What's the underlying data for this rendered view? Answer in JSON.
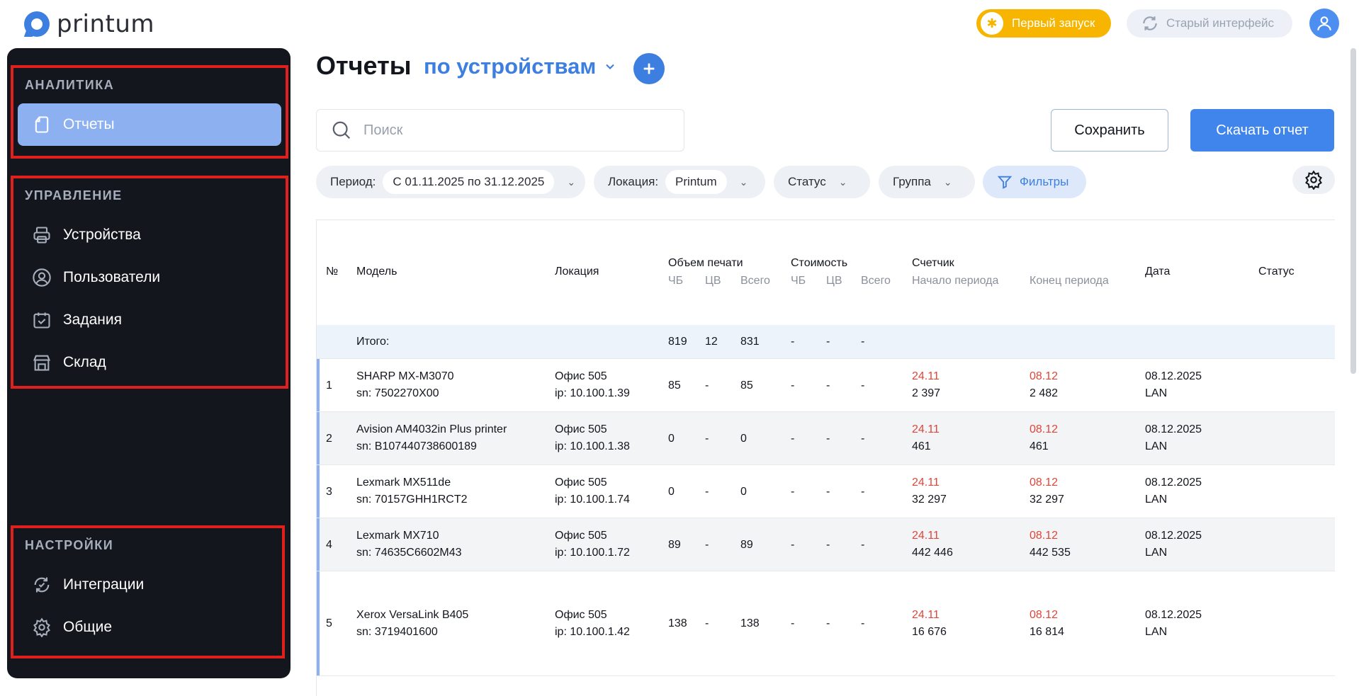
{
  "brand": {
    "name": "printum"
  },
  "header": {
    "first_launch": "Первый запуск",
    "old_interface": "Старый интерфейс"
  },
  "sidebar": {
    "analytics": {
      "title": "АНАЛИТИКА",
      "items": [
        {
          "label": "Отчеты",
          "icon": "document-icon"
        }
      ]
    },
    "management": {
      "title": "УПРАВЛЕНИЕ",
      "items": [
        {
          "label": "Устройства",
          "icon": "printer-icon"
        },
        {
          "label": "Пользователи",
          "icon": "user-icon"
        },
        {
          "label": "Задания",
          "icon": "calendar-check-icon"
        },
        {
          "label": "Склад",
          "icon": "warehouse-icon"
        }
      ]
    },
    "settings": {
      "title": "НАСТРОЙКИ",
      "items": [
        {
          "label": "Интеграции",
          "icon": "sync-icon"
        },
        {
          "label": "Общие",
          "icon": "gear-icon"
        }
      ]
    }
  },
  "main": {
    "title": "Отчеты",
    "subtitle": "по устройствам",
    "search_placeholder": "Поиск",
    "save": "Сохранить",
    "download": "Скачать отчет",
    "filters": {
      "period_label": "Период:",
      "period_value": "С 01.11.2025 по 31.12.2025",
      "location_label": "Локация:",
      "location_value": "Printum",
      "status": "Статус",
      "group": "Группа",
      "filters": "Фильтры"
    }
  },
  "table": {
    "headers": {
      "num": "№",
      "model": "Модель",
      "location": "Локация",
      "volume": "Объем печати",
      "cost": "Стоимость",
      "counter": "Счетчик",
      "date": "Дата",
      "status": "Статус",
      "bw": "ЧБ",
      "color": "ЦВ",
      "total": "Всего",
      "period_start": "Начало периода",
      "period_end": "Конец периода"
    },
    "total_row": {
      "label": "Итого:",
      "bw": "819",
      "color": "12",
      "total": "831",
      "c_bw": "-",
      "c_color": "-",
      "c_total": "-"
    },
    "rows": [
      {
        "n": "1",
        "model": "SHARP MX-M3070",
        "sn": "sn: 7502270X00",
        "loc": "Офис 505",
        "ip": "ip: 10.100.1.39",
        "bw": "85",
        "color": "-",
        "total": "85",
        "c_bw": "-",
        "c_color": "-",
        "c_total": "-",
        "start_date": "24.11",
        "start_val": "2 397",
        "end_date": "08.12",
        "end_val": "2 482",
        "date": "08.12.2025",
        "conn": "LAN"
      },
      {
        "n": "2",
        "model": "Avision AM4032in Plus printer",
        "sn": "sn: B107440738600189",
        "loc": "Офис 505",
        "ip": "ip: 10.100.1.38",
        "bw": "0",
        "color": "-",
        "total": "0",
        "c_bw": "-",
        "c_color": "-",
        "c_total": "-",
        "start_date": "24.11",
        "start_val": "461",
        "end_date": "08.12",
        "end_val": "461",
        "date": "08.12.2025",
        "conn": "LAN"
      },
      {
        "n": "3",
        "model": "Lexmark MX511de",
        "sn": "sn: 70157GHH1RCT2",
        "loc": "Офис 505",
        "ip": "ip: 10.100.1.74",
        "bw": "0",
        "color": "-",
        "total": "0",
        "c_bw": "-",
        "c_color": "-",
        "c_total": "-",
        "start_date": "24.11",
        "start_val": "32 297",
        "end_date": "08.12",
        "end_val": "32 297",
        "date": "08.12.2025",
        "conn": "LAN"
      },
      {
        "n": "4",
        "model": "Lexmark MX710",
        "sn": "sn: 74635C6602M43",
        "loc": "Офис 505",
        "ip": "ip: 10.100.1.72",
        "bw": "89",
        "color": "-",
        "total": "89",
        "c_bw": "-",
        "c_color": "-",
        "c_total": "-",
        "start_date": "24.11",
        "start_val": "442 446",
        "end_date": "08.12",
        "end_val": "442 535",
        "date": "08.12.2025",
        "conn": "LAN"
      },
      {
        "n": "5",
        "model": "Xerox VersaLink B405",
        "sn": "sn: 3719401600",
        "loc": "Офис 505",
        "ip": "ip: 10.100.1.42",
        "bw": "138",
        "color": "-",
        "total": "138",
        "c_bw": "-",
        "c_color": "-",
        "c_total": "-",
        "start_date": "24.11",
        "start_val": "16 676",
        "end_date": "08.12",
        "end_val": "16 814",
        "date": "08.12.2025",
        "conn": "LAN"
      }
    ]
  },
  "colors": {
    "accent": "#3d7fe0",
    "warning": "#f7b500",
    "sidebar": "#13161d",
    "highlight_border": "#e0201d",
    "counter_date": "#e0453a"
  }
}
